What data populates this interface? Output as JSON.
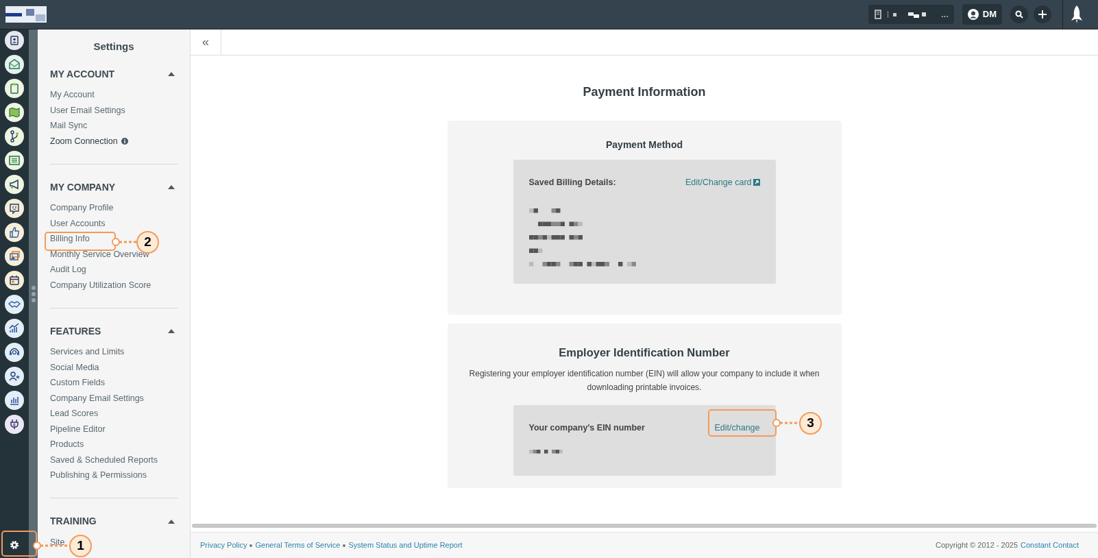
{
  "topbar": {
    "account_button": {
      "label": "..."
    },
    "user_button": {
      "initials": "DM"
    }
  },
  "sidebar": {
    "title": "Settings",
    "sections": [
      {
        "heading": "MY ACCOUNT",
        "expanded": true,
        "items": [
          {
            "label": "My Account"
          },
          {
            "label": "User Email Settings"
          },
          {
            "label": "Mail Sync"
          },
          {
            "label": "Zoom Connection",
            "kind": "info"
          }
        ]
      },
      {
        "heading": "MY COMPANY",
        "expanded": true,
        "items": [
          {
            "label": "Company Profile"
          },
          {
            "label": "User Accounts"
          },
          {
            "label": "Billing Info"
          },
          {
            "label": "Monthly Service Overview"
          },
          {
            "label": "Audit Log"
          },
          {
            "label": "Company Utilization Score"
          }
        ]
      },
      {
        "heading": "FEATURES",
        "expanded": true,
        "items": [
          {
            "label": "Services and Limits"
          },
          {
            "label": "Social Media"
          },
          {
            "label": "Custom Fields"
          },
          {
            "label": "Company Email Settings"
          },
          {
            "label": "Lead Scores"
          },
          {
            "label": "Pipeline Editor"
          },
          {
            "label": "Products"
          },
          {
            "label": "Saved & Scheduled Reports"
          },
          {
            "label": "Publishing & Permissions"
          }
        ]
      },
      {
        "heading": "TRAINING",
        "expanded": true,
        "items": [
          {
            "label": "Site"
          }
        ]
      }
    ]
  },
  "collapse_button": {
    "label": "«"
  },
  "page_title": "Payment Information",
  "payment_method": {
    "title": "Payment Method",
    "label": "Saved Billing Details:",
    "link": "Edit/Change card"
  },
  "ein": {
    "title": "Employer Identification Number",
    "description": "Registering your employer identification number (EIN) will allow your company to include it when downloading printable invoices.",
    "label": "Your company's EIN number",
    "link": "Edit/change"
  },
  "footer": {
    "links": [
      "Privacy Policy",
      "General Terms of Service",
      "System Status and Uptime Report"
    ],
    "copyright": "Copyright © 2012 - 2025",
    "company_link": "Constant Contact"
  },
  "callouts": [
    {
      "number": "1"
    },
    {
      "number": "2"
    },
    {
      "number": "3"
    }
  ]
}
